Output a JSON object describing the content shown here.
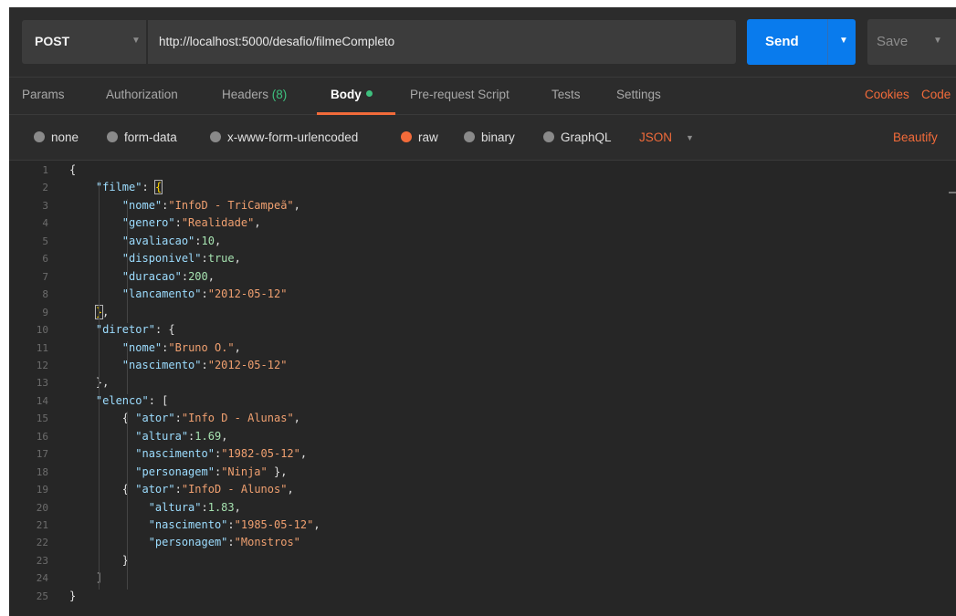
{
  "request": {
    "method": "POST",
    "url": "http://localhost:5000/desafio/filmeCompleto",
    "send_label": "Send",
    "save_label": "Save"
  },
  "tabs": [
    {
      "label": "Params"
    },
    {
      "label": "Authorization"
    },
    {
      "label": "Headers",
      "count": "(8)"
    },
    {
      "label": "Body",
      "active": true
    },
    {
      "label": "Pre-request Script"
    },
    {
      "label": "Tests"
    },
    {
      "label": "Settings"
    }
  ],
  "right_links": {
    "cookies": "Cookies",
    "code": "Code"
  },
  "body_types": [
    {
      "label": "none"
    },
    {
      "label": "form-data"
    },
    {
      "label": "x-www-form-urlencoded"
    },
    {
      "label": "raw",
      "selected": true
    },
    {
      "label": "binary"
    },
    {
      "label": "GraphQL"
    }
  ],
  "format_select": "JSON",
  "beautify_label": "Beautify",
  "editor": {
    "line_numbers": [
      "1",
      "2",
      "3",
      "4",
      "5",
      "6",
      "7",
      "8",
      "9",
      "10",
      "11",
      "12",
      "13",
      "14",
      "15",
      "16",
      "17",
      "18",
      "19",
      "20",
      "21",
      "22",
      "23",
      "24",
      "25"
    ],
    "lines": [
      "{",
      "    \"filme\": {",
      "        \"nome\":\"InfoD - TriCampeã\",",
      "        \"genero\":\"Realidade\",",
      "        \"avaliacao\":10,",
      "        \"disponivel\":true,",
      "        \"duracao\":200,",
      "        \"lancamento\":\"2012-05-12\"",
      "    },",
      "    \"diretor\": {",
      "        \"nome\":\"Bruno O.\",",
      "        \"nascimento\":\"2012-05-12\"",
      "    },",
      "    \"elenco\": [",
      "        { \"ator\":\"Info D - Alunas\",",
      "          \"altura\":1.69,",
      "          \"nascimento\":\"1982-05-12\",",
      "          \"personagem\":\"Ninja\" },",
      "        { \"ator\":\"InfoD - Alunos\",",
      "            \"altura\":1.83,",
      "            \"nascimento\":\"1985-05-12\",",
      "            \"personagem\":\"Monstros\"",
      "        }",
      "    ]",
      "}"
    ]
  },
  "colors": {
    "accent": "#f26b3a",
    "send": "#097bed",
    "key": "#9cdcfe",
    "string": "#f0a070",
    "number": "#a6e2b0",
    "status_green": "#3ec07e"
  },
  "icons": {
    "method_caret": "chevron-down-icon",
    "send_caret": "chevron-down-icon",
    "save_caret": "chevron-down-icon"
  }
}
